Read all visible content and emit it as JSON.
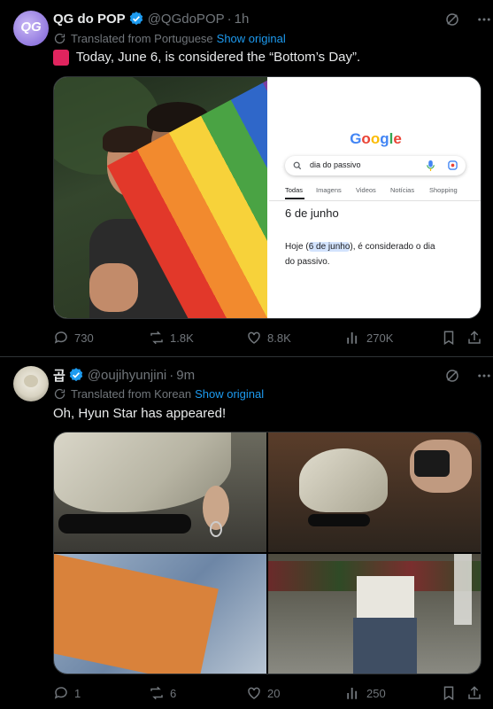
{
  "tweets": [
    {
      "author": "QG do POP",
      "handle": "@QGdoPOP",
      "time": "1h",
      "translated_from": "Translated from Portuguese",
      "show_original": "Show original",
      "siren_emoji": "🚨",
      "text": "Today, June 6, is considered the “Bottom’s Day”.",
      "avatar_text": "QG",
      "google_card": {
        "logo": "Google",
        "query": "dia do passivo",
        "tabs": [
          "Todas",
          "Imagens",
          "Videos",
          "Notícias",
          "Shopping"
        ],
        "heading": "6 de junho",
        "answer_pre": "Hoje (",
        "answer_highlight": "6 de junho",
        "answer_post": "), é considerado o dia",
        "answer_line2": "do passivo."
      },
      "stats": {
        "replies": "730",
        "reposts": "1.8K",
        "likes": "8.8K",
        "views": "270K"
      }
    },
    {
      "author": "곱",
      "handle": "@oujihyunjini",
      "time": "9m",
      "translated_from": "Translated from Korean",
      "show_original": "Show original",
      "text": "Oh, Hyun Star has appeared!",
      "stats": {
        "replies": "1",
        "reposts": "6",
        "likes": "20",
        "views": "250"
      }
    }
  ],
  "colors": {
    "accent": "#1d9bf0",
    "muted": "#71767b",
    "text": "#e7e9ea",
    "background": "#000000",
    "divider": "#2f3336"
  }
}
